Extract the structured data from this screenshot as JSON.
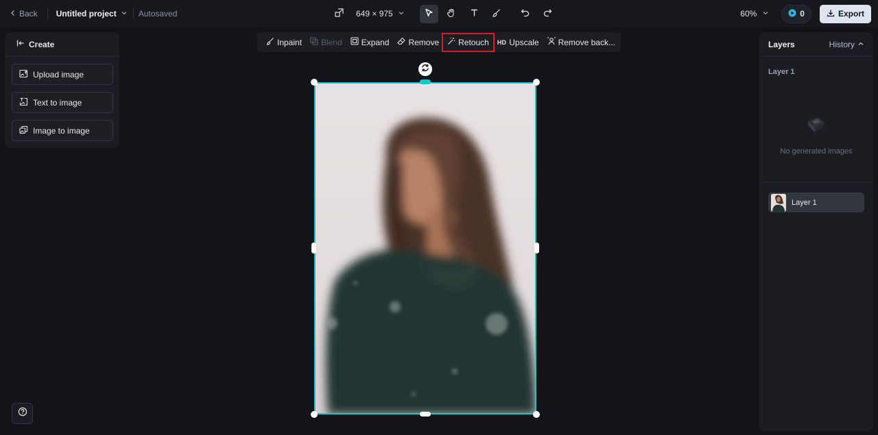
{
  "topbar": {
    "back_label": "Back",
    "project_name": "Untitled project",
    "save_status": "Autosaved",
    "canvas_size": "649 × 975",
    "zoom": "60%",
    "credits": "0",
    "export_label": "Export"
  },
  "create_panel": {
    "title": "Create",
    "items": [
      {
        "label": "Upload image",
        "icon": "upload-image-icon"
      },
      {
        "label": "Text to image",
        "icon": "text-to-image-icon"
      },
      {
        "label": "Image to image",
        "icon": "image-to-image-icon"
      }
    ]
  },
  "actions": {
    "inpaint": "Inpaint",
    "blend": "Blend",
    "expand": "Expand",
    "remove": "Remove",
    "retouch": "Retouch",
    "upscale_badge": "HD",
    "upscale": "Upscale",
    "remove_background": "Remove back..."
  },
  "layers_panel": {
    "title": "Layers",
    "history_label": "History",
    "group_label": "Layer 1",
    "empty_text": "No generated images",
    "layers": [
      {
        "name": "Layer 1"
      }
    ]
  },
  "colors": {
    "accent_frame": "#19c6c9",
    "highlight": "#d11f2a",
    "background": "#121419",
    "panel": "#1b1d22"
  }
}
